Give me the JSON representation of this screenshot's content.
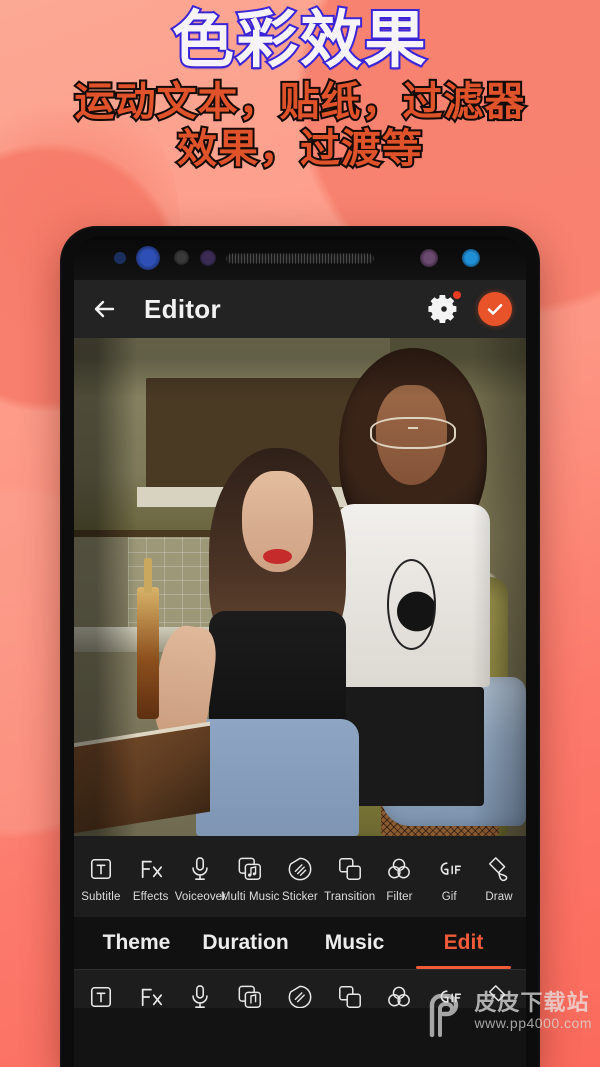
{
  "promo": {
    "headline": "色彩效果",
    "subhead_line1": "运动文本，贴纸，过滤器",
    "subhead_line2": "效果，过渡等",
    "headline_color": "#f6f3fb",
    "headline_outline_color": "#3a24d6",
    "subhead_color": "#e0522a",
    "subhead_outline_color": "#140a06",
    "background_color": "#fa8072"
  },
  "app": {
    "appbar": {
      "back_icon": "back-arrow-icon",
      "title": "Editor",
      "settings_icon": "gear-icon",
      "settings_badge": true,
      "confirm_icon": "check-circle-icon",
      "confirm_color": "#e8532a",
      "bar_color": "#232323"
    },
    "tools": [
      {
        "label": "Subtitle",
        "icon": "subtitle-icon"
      },
      {
        "label": "Effects",
        "icon": "fx-icon"
      },
      {
        "label": "Voiceover",
        "icon": "microphone-icon"
      },
      {
        "label": "Multi Music",
        "icon": "multi-music-icon"
      },
      {
        "label": "Sticker",
        "icon": "sticker-icon"
      },
      {
        "label": "Transition",
        "icon": "transition-icon"
      },
      {
        "label": "Filter",
        "icon": "filter-icon"
      },
      {
        "label": "Gif",
        "icon": "gif-icon"
      },
      {
        "label": "Draw",
        "icon": "draw-brush-icon"
      }
    ],
    "tabs": [
      {
        "label": "Theme",
        "active": false
      },
      {
        "label": "Duration",
        "active": false
      },
      {
        "label": "Music",
        "active": false
      },
      {
        "label": "Edit",
        "active": true
      }
    ],
    "accent_color": "#ef5b38"
  },
  "watermark": {
    "logo_icon": "pp-logo-icon",
    "site_name": "皮皮下载站",
    "url": "www.pp4000.com"
  }
}
